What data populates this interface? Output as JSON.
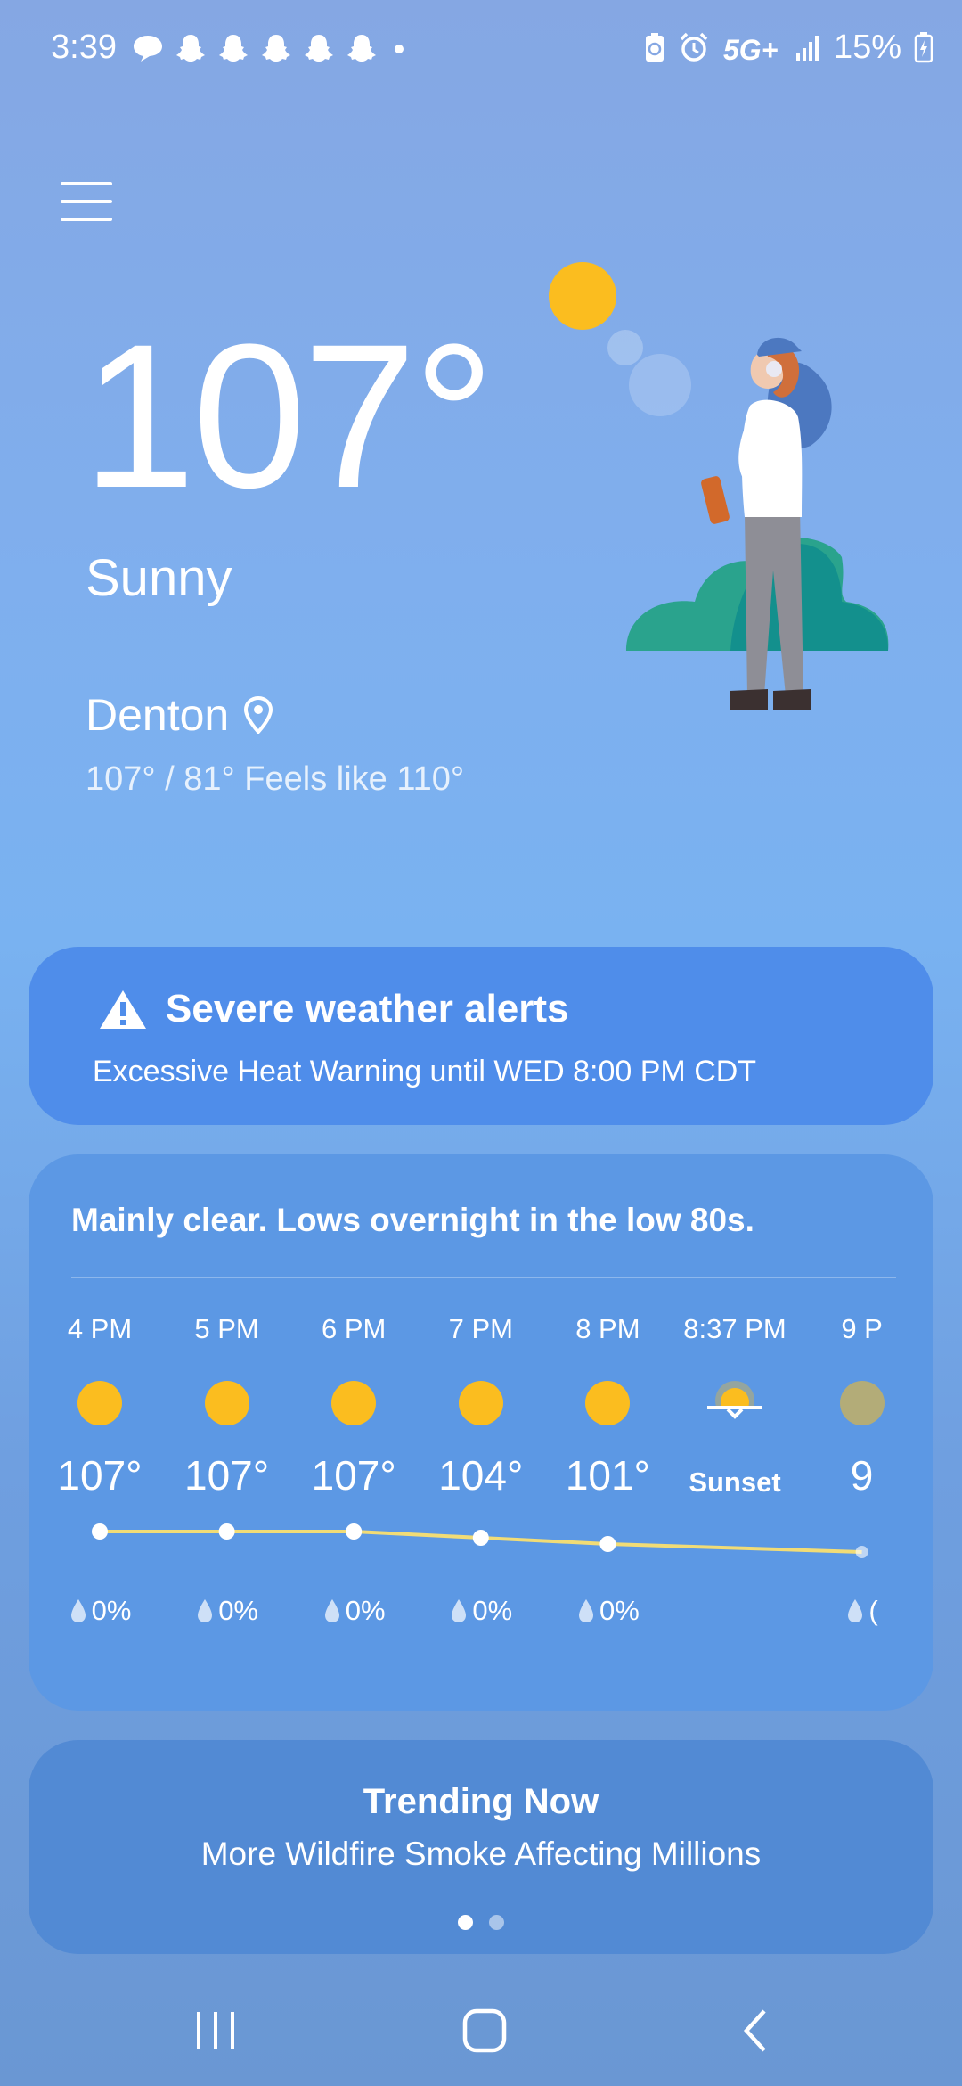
{
  "status_bar": {
    "time": "3:39",
    "network": "5G+",
    "battery": "15%",
    "notification_icons": [
      "messages-icon",
      "snapchat-icon",
      "snapchat-icon",
      "snapchat-icon",
      "snapchat-icon",
      "snapchat-icon",
      "more-dot-icon"
    ],
    "system_icons": [
      "recycle-battery-icon",
      "alarm-icon",
      "signal-icon",
      "battery-charging-icon"
    ]
  },
  "current": {
    "temperature": "107°",
    "condition": "Sunny",
    "location": "Denton",
    "hilo_feels": "107° / 81° Feels like 110°"
  },
  "alert": {
    "title": "Severe weather alerts",
    "subtitle": "Excessive Heat Warning until WED 8:00 PM CDT"
  },
  "forecast": {
    "summary": "Mainly clear. Lows overnight in the low 80s.",
    "hours": [
      {
        "time": "4 PM",
        "icon": "sun-icon",
        "temp": "107°",
        "precip": "0%"
      },
      {
        "time": "5 PM",
        "icon": "sun-icon",
        "temp": "107°",
        "precip": "0%"
      },
      {
        "time": "6 PM",
        "icon": "sun-icon",
        "temp": "107°",
        "precip": "0%"
      },
      {
        "time": "7 PM",
        "icon": "sun-icon",
        "temp": "104°",
        "precip": "0%"
      },
      {
        "time": "8 PM",
        "icon": "sun-icon",
        "temp": "101°",
        "precip": "0%"
      },
      {
        "time": "8:37 PM",
        "icon": "sunset-icon",
        "temp": "Sunset",
        "precip": ""
      },
      {
        "time": "9 P",
        "icon": "moon-icon",
        "temp": "9",
        "precip": "("
      }
    ]
  },
  "trending": {
    "title": "Trending Now",
    "subtitle": "More Wildfire Smoke Affecting Millions",
    "page_count": 2,
    "active_page": 1
  },
  "nav": {
    "buttons": [
      "recents-icon",
      "home-icon",
      "back-icon"
    ]
  },
  "colors": {
    "sun": "#fbbd1f",
    "temp_line": "#f1dc76",
    "alert_card": "#4f8dea",
    "forecast_card": "#5c98e4",
    "trend_card": "#528ad4"
  }
}
